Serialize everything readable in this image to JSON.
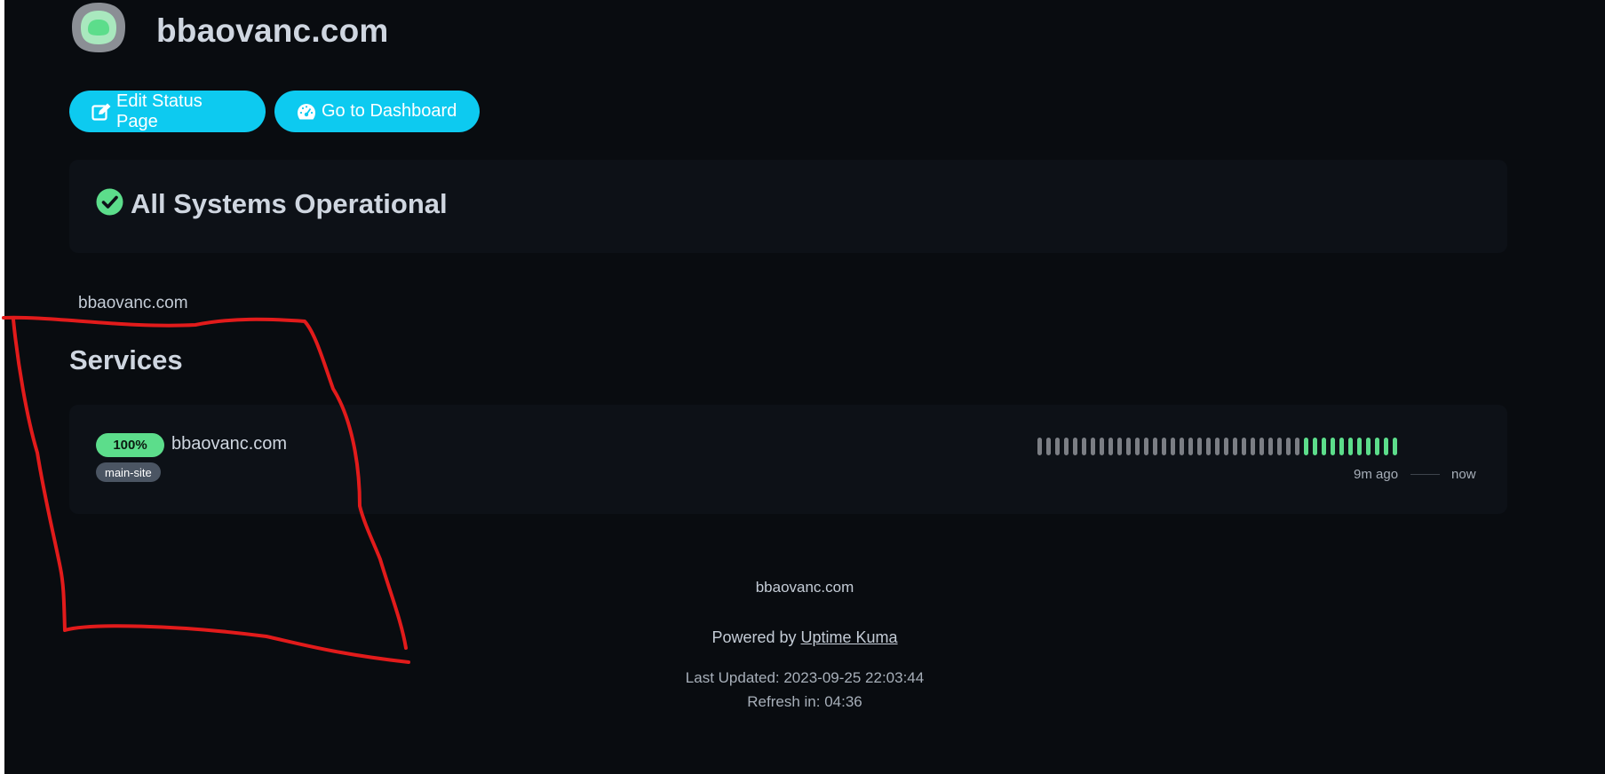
{
  "header": {
    "site_title": "bbaovanc.com",
    "logo": "uptime-kuma-logo"
  },
  "buttons": {
    "edit_label": "Edit Status Page",
    "edit_icon": "edit-icon",
    "dashboard_label": "Go to Dashboard",
    "dashboard_icon": "speedometer-icon"
  },
  "status": {
    "label": "All Systems Operational",
    "icon": "check-circle-icon",
    "color": "#5cdd8b"
  },
  "description": "bbaovanc.com",
  "services": {
    "title": "Services",
    "items": [
      {
        "uptime": "100%",
        "name": "bbaovanc.com",
        "tag": "main-site",
        "heartbeats": [
          "empty",
          "empty",
          "empty",
          "empty",
          "empty",
          "empty",
          "empty",
          "empty",
          "empty",
          "empty",
          "empty",
          "empty",
          "empty",
          "empty",
          "empty",
          "empty",
          "empty",
          "empty",
          "empty",
          "empty",
          "empty",
          "empty",
          "empty",
          "empty",
          "empty",
          "empty",
          "empty",
          "empty",
          "empty",
          "empty",
          "up",
          "up",
          "up",
          "up",
          "up",
          "up",
          "up",
          "up",
          "up",
          "up",
          "up"
        ],
        "beat_legend_start": "9m ago",
        "beat_legend_end": "now"
      }
    ]
  },
  "footer": {
    "text": "bbaovanc.com",
    "powered_prefix": "Powered by",
    "powered_link": "Uptime Kuma",
    "last_updated": "Last Updated: 2023-09-25 22:03:44",
    "refresh": "Refresh in: 04:36"
  },
  "colors": {
    "accent": "#0dcaf0",
    "up": "#5cdd8b",
    "empty": "#7b7e84",
    "background": "#090c10",
    "card": "#0d1117",
    "annotation": "#e21b1b"
  }
}
